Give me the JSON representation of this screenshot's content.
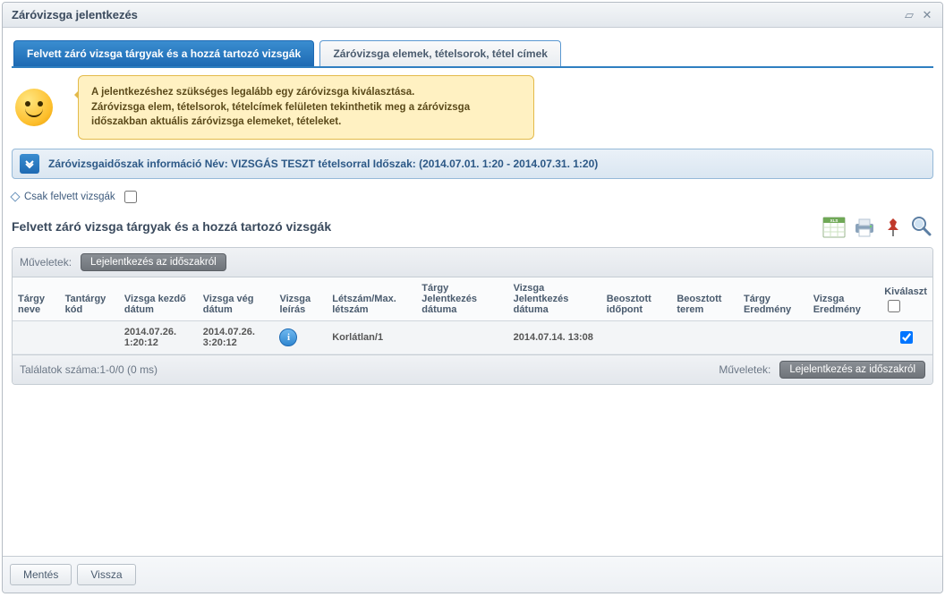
{
  "window": {
    "title": "Záróvizsga jelentkezés"
  },
  "tabs": {
    "active": "Felvett záró vizsga tárgyak és a hozzá tartozó vizsgák",
    "inactive": "Záróvizsga elemek, tételsorok, tétel címek"
  },
  "speech": {
    "line1": "A jelentkezéshez szükséges legalább egy záróvizsga kiválasztása.",
    "line2": "Záróvizsga elem, tételsorok, tételcímek felületen tekinthetik meg a záróvizsga időszakban aktuális záróvizsga elemeket, tételeket."
  },
  "period": {
    "label": "Záróvizsgaidőszak információ Név: VIZSGÁS TESZT tételsorral Időszak: (2014.07.01. 1:20 - 2014.07.31. 1:20)"
  },
  "only_exams": {
    "label": "Csak felvett vizsgák"
  },
  "section": {
    "title": "Felvett záró vizsga tárgyak és a hozzá tartozó vizsgák"
  },
  "ops": {
    "label": "Műveletek:",
    "btn": "Lejelentkezés az időszakról"
  },
  "columns": {
    "c0": "Tárgy neve",
    "c1": "Tantárgy kód",
    "c2": "Vizsga kezdő dátum",
    "c3": "Vizsga vég dátum",
    "c4": "Vizsga leírás",
    "c5": "Létszám/Max. létszám",
    "c6": "Tárgy Jelentkezés dátuma",
    "c7": "Vizsga Jelentkezés dátuma",
    "c8": "Beosztott időpont",
    "c9": "Beosztott terem",
    "c10": "Tárgy Eredmény",
    "c11": "Vizsga Eredmény",
    "c12": "Kiválaszt"
  },
  "row": {
    "c0": "",
    "c1": "",
    "c2": "2014.07.26. 1:20:12",
    "c3": "2014.07.26. 3:20:12",
    "c5": "Korlátlan/1",
    "c6": "",
    "c7": "2014.07.14. 13:08",
    "c8": "",
    "c9": "",
    "c10": "",
    "c11": ""
  },
  "results": {
    "text": "Találatok száma:1-0/0 (0 ms)"
  },
  "footer": {
    "save": "Mentés",
    "back": "Vissza"
  }
}
